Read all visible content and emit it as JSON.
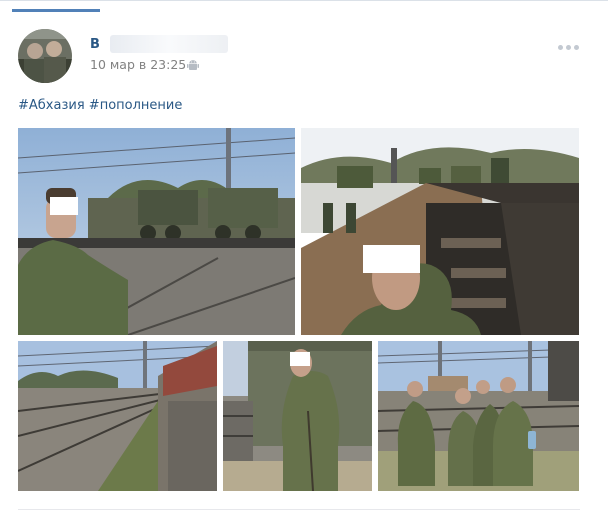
{
  "post": {
    "author_initial": "В",
    "date": "10 мар в 23:25",
    "platform_icon": "android-icon",
    "menu_icon": "more-dots-icon"
  },
  "hashtags": [
    "#Абхазия",
    "#пополнение"
  ],
  "photos": [
    {
      "id": "photo-1"
    },
    {
      "id": "photo-2"
    },
    {
      "id": "photo-3"
    },
    {
      "id": "photo-4"
    },
    {
      "id": "photo-5"
    }
  ],
  "colors": {
    "link": "#2a5885",
    "meta": "#828282",
    "accent": "#5181b8"
  }
}
